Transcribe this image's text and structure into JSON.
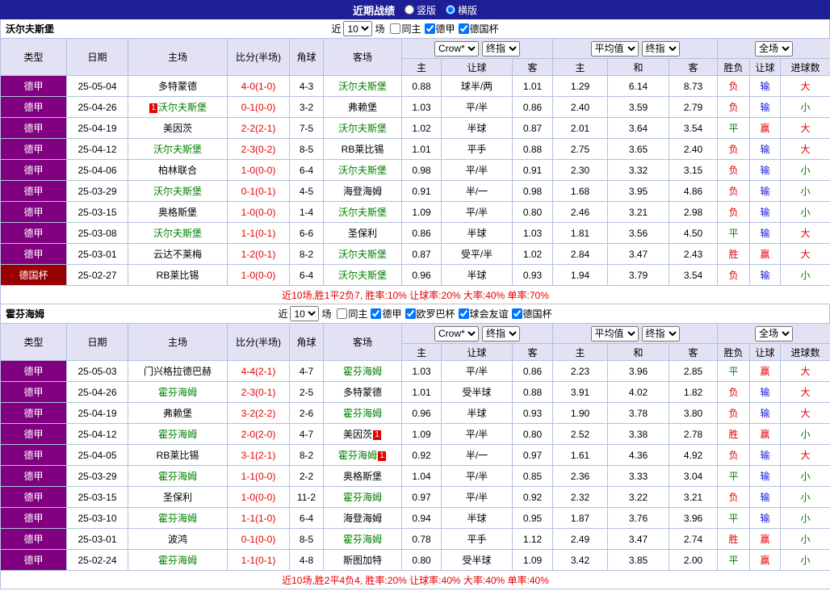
{
  "topbar": {
    "title": "近期战绩",
    "radios": [
      {
        "label": "竖版",
        "checked": false
      },
      {
        "label": "横版",
        "checked": true
      }
    ]
  },
  "colors": {
    "topbar_bg": "#1e1e96",
    "header_bg": "#e2e2f4",
    "border": "#b3c1dd",
    "focus_team": "#008000",
    "score": "#e60000",
    "summary": "#e60000",
    "badge_bg": "#e60000"
  },
  "league_colors": {
    "德甲": "#800080",
    "德国杯": "#990000"
  },
  "value_colors": {
    "胜": "#e60000",
    "平": "#008000",
    "负": "#e60000",
    "赢": "#e60000",
    "输": "#1515dd",
    "大": "#e60000",
    "小": "#008000"
  },
  "sections": [
    {
      "team": "沃尔夫斯堡",
      "filter": {
        "near_label": "近",
        "games_value": "10",
        "games_suffix": "场",
        "checkboxes": [
          {
            "label": "同主",
            "checked": false
          },
          {
            "label": "德甲",
            "checked": true
          },
          {
            "label": "德国杯",
            "checked": true
          }
        ]
      },
      "header": {
        "col_type": "类型",
        "col_date": "日期",
        "col_home": "主场",
        "col_score": "比分(半场)",
        "col_corner": "角球",
        "col_away": "客场",
        "select_company": "Crow*",
        "select_final1": "终指",
        "select_avg": "平均值",
        "select_final2": "终指",
        "select_full": "全场",
        "sub": [
          "主",
          "让球",
          "客",
          "主",
          "和",
          "客",
          "胜负",
          "让球",
          "进球数"
        ]
      },
      "rows": [
        {
          "league": "德甲",
          "date": "25-05-04",
          "home": {
            "name": "多特蒙德"
          },
          "score": "4-0(1-0)",
          "corner": "4-3",
          "away": {
            "name": "沃尔夫斯堡",
            "focus": true
          },
          "odds": [
            "0.88",
            "球半/两",
            "1.01",
            "1.29",
            "6.14",
            "8.73"
          ],
          "results": [
            "负",
            "输",
            "大"
          ]
        },
        {
          "league": "德甲",
          "date": "25-04-26",
          "home": {
            "name": "沃尔夫斯堡",
            "focus": true,
            "badge_before": "1"
          },
          "score": "0-1(0-0)",
          "corner": "3-2",
          "away": {
            "name": "弗赖堡"
          },
          "odds": [
            "1.03",
            "平/半",
            "0.86",
            "2.40",
            "3.59",
            "2.79"
          ],
          "results": [
            "负",
            "输",
            "小"
          ]
        },
        {
          "league": "德甲",
          "date": "25-04-19",
          "home": {
            "name": "美因茨"
          },
          "score": "2-2(2-1)",
          "corner": "7-5",
          "away": {
            "name": "沃尔夫斯堡",
            "focus": true
          },
          "odds": [
            "1.02",
            "半球",
            "0.87",
            "2.01",
            "3.64",
            "3.54"
          ],
          "results": [
            "平",
            "赢",
            "大"
          ]
        },
        {
          "league": "德甲",
          "date": "25-04-12",
          "home": {
            "name": "沃尔夫斯堡",
            "focus": true
          },
          "score": "2-3(0-2)",
          "corner": "8-5",
          "away": {
            "name": "RB莱比锡"
          },
          "odds": [
            "1.01",
            "平手",
            "0.88",
            "2.75",
            "3.65",
            "2.40"
          ],
          "results": [
            "负",
            "输",
            "大"
          ]
        },
        {
          "league": "德甲",
          "date": "25-04-06",
          "home": {
            "name": "柏林联合"
          },
          "score": "1-0(0-0)",
          "corner": "6-4",
          "away": {
            "name": "沃尔夫斯堡",
            "focus": true
          },
          "odds": [
            "0.98",
            "平/半",
            "0.91",
            "2.30",
            "3.32",
            "3.15"
          ],
          "results": [
            "负",
            "输",
            "小"
          ]
        },
        {
          "league": "德甲",
          "date": "25-03-29",
          "home": {
            "name": "沃尔夫斯堡",
            "focus": true
          },
          "score": "0-1(0-1)",
          "corner": "4-5",
          "away": {
            "name": "海登海姆"
          },
          "odds": [
            "0.91",
            "半/一",
            "0.98",
            "1.68",
            "3.95",
            "4.86"
          ],
          "results": [
            "负",
            "输",
            "小"
          ]
        },
        {
          "league": "德甲",
          "date": "25-03-15",
          "home": {
            "name": "奥格斯堡"
          },
          "score": "1-0(0-0)",
          "corner": "1-4",
          "away": {
            "name": "沃尔夫斯堡",
            "focus": true
          },
          "odds": [
            "1.09",
            "平/半",
            "0.80",
            "2.46",
            "3.21",
            "2.98"
          ],
          "results": [
            "负",
            "输",
            "小"
          ]
        },
        {
          "league": "德甲",
          "date": "25-03-08",
          "home": {
            "name": "沃尔夫斯堡",
            "focus": true
          },
          "score": "1-1(0-1)",
          "corner": "6-6",
          "away": {
            "name": "圣保利"
          },
          "odds": [
            "0.86",
            "半球",
            "1.03",
            "1.81",
            "3.56",
            "4.50"
          ],
          "results": [
            "平",
            "输",
            "大"
          ]
        },
        {
          "league": "德甲",
          "date": "25-03-01",
          "home": {
            "name": "云达不莱梅"
          },
          "score": "1-2(0-1)",
          "corner": "8-2",
          "away": {
            "name": "沃尔夫斯堡",
            "focus": true
          },
          "odds": [
            "0.87",
            "受平/半",
            "1.02",
            "2.84",
            "3.47",
            "2.43"
          ],
          "results": [
            "胜",
            "赢",
            "大"
          ]
        },
        {
          "league": "德国杯",
          "date": "25-02-27",
          "home": {
            "name": "RB莱比锡"
          },
          "score": "1-0(0-0)",
          "corner": "6-4",
          "away": {
            "name": "沃尔夫斯堡",
            "focus": true
          },
          "odds": [
            "0.96",
            "半球",
            "0.93",
            "1.94",
            "3.79",
            "3.54"
          ],
          "results": [
            "负",
            "输",
            "小"
          ]
        }
      ],
      "summary": "近10场,胜1平2负7, 胜率:10% 让球率:20% 大率:40% 单率:70%"
    },
    {
      "team": "霍芬海姆",
      "filter": {
        "near_label": "近",
        "games_value": "10",
        "games_suffix": "场",
        "checkboxes": [
          {
            "label": "同主",
            "checked": false
          },
          {
            "label": "德甲",
            "checked": true
          },
          {
            "label": "欧罗巴杯",
            "checked": true
          },
          {
            "label": "球会友谊",
            "checked": true
          },
          {
            "label": "德国杯",
            "checked": true
          }
        ]
      },
      "header": {
        "col_type": "类型",
        "col_date": "日期",
        "col_home": "主场",
        "col_score": "比分(半场)",
        "col_corner": "角球",
        "col_away": "客场",
        "select_company": "Crow*",
        "select_final1": "终指",
        "select_avg": "平均值",
        "select_final2": "终指",
        "select_full": "全场",
        "sub": [
          "主",
          "让球",
          "客",
          "主",
          "和",
          "客",
          "胜负",
          "让球",
          "进球数"
        ]
      },
      "rows": [
        {
          "league": "德甲",
          "date": "25-05-03",
          "home": {
            "name": "门兴格拉德巴赫"
          },
          "score": "4-4(2-1)",
          "corner": "4-7",
          "away": {
            "name": "霍芬海姆",
            "focus": true
          },
          "odds": [
            "1.03",
            "平/半",
            "0.86",
            "2.23",
            "3.96",
            "2.85"
          ],
          "results": [
            "平",
            "赢",
            "大"
          ]
        },
        {
          "league": "德甲",
          "date": "25-04-26",
          "home": {
            "name": "霍芬海姆",
            "focus": true
          },
          "score": "2-3(0-1)",
          "corner": "2-5",
          "away": {
            "name": "多特蒙德"
          },
          "odds": [
            "1.01",
            "受半球",
            "0.88",
            "3.91",
            "4.02",
            "1.82"
          ],
          "results": [
            "负",
            "输",
            "大"
          ]
        },
        {
          "league": "德甲",
          "date": "25-04-19",
          "home": {
            "name": "弗赖堡"
          },
          "score": "3-2(2-2)",
          "corner": "2-6",
          "away": {
            "name": "霍芬海姆",
            "focus": true
          },
          "odds": [
            "0.96",
            "半球",
            "0.93",
            "1.90",
            "3.78",
            "3.80"
          ],
          "results": [
            "负",
            "输",
            "大"
          ]
        },
        {
          "league": "德甲",
          "date": "25-04-12",
          "home": {
            "name": "霍芬海姆",
            "focus": true
          },
          "score": "2-0(2-0)",
          "corner": "4-7",
          "away": {
            "name": "美因茨",
            "badge_after": "1"
          },
          "odds": [
            "1.09",
            "平/半",
            "0.80",
            "2.52",
            "3.38",
            "2.78"
          ],
          "results": [
            "胜",
            "赢",
            "小"
          ]
        },
        {
          "league": "德甲",
          "date": "25-04-05",
          "home": {
            "name": "RB莱比锡"
          },
          "score": "3-1(2-1)",
          "corner": "8-2",
          "away": {
            "name": "霍芬海姆",
            "focus": true,
            "badge_after": "1"
          },
          "odds": [
            "0.92",
            "半/一",
            "0.97",
            "1.61",
            "4.36",
            "4.92"
          ],
          "results": [
            "负",
            "输",
            "大"
          ]
        },
        {
          "league": "德甲",
          "date": "25-03-29",
          "home": {
            "name": "霍芬海姆",
            "focus": true
          },
          "score": "1-1(0-0)",
          "corner": "2-2",
          "away": {
            "name": "奥格斯堡"
          },
          "odds": [
            "1.04",
            "平/半",
            "0.85",
            "2.36",
            "3.33",
            "3.04"
          ],
          "results": [
            "平",
            "输",
            "小"
          ]
        },
        {
          "league": "德甲",
          "date": "25-03-15",
          "home": {
            "name": "圣保利"
          },
          "score": "1-0(0-0)",
          "corner": "11-2",
          "away": {
            "name": "霍芬海姆",
            "focus": true
          },
          "odds": [
            "0.97",
            "平/半",
            "0.92",
            "2.32",
            "3.22",
            "3.21"
          ],
          "results": [
            "负",
            "输",
            "小"
          ]
        },
        {
          "league": "德甲",
          "date": "25-03-10",
          "home": {
            "name": "霍芬海姆",
            "focus": true
          },
          "score": "1-1(1-0)",
          "corner": "6-4",
          "away": {
            "name": "海登海姆"
          },
          "odds": [
            "0.94",
            "半球",
            "0.95",
            "1.87",
            "3.76",
            "3.96"
          ],
          "results": [
            "平",
            "输",
            "小"
          ]
        },
        {
          "league": "德甲",
          "date": "25-03-01",
          "home": {
            "name": "波鸿"
          },
          "score": "0-1(0-0)",
          "corner": "8-5",
          "away": {
            "name": "霍芬海姆",
            "focus": true
          },
          "odds": [
            "0.78",
            "平手",
            "1.12",
            "2.49",
            "3.47",
            "2.74"
          ],
          "results": [
            "胜",
            "赢",
            "小"
          ]
        },
        {
          "league": "德甲",
          "date": "25-02-24",
          "home": {
            "name": "霍芬海姆",
            "focus": true
          },
          "score": "1-1(0-1)",
          "corner": "4-8",
          "away": {
            "name": "斯图加特"
          },
          "odds": [
            "0.80",
            "受半球",
            "1.09",
            "3.42",
            "3.85",
            "2.00"
          ],
          "results": [
            "平",
            "赢",
            "小"
          ]
        }
      ],
      "summary": "近10场,胜2平4负4, 胜率:20% 让球率:40% 大率:40% 单率:40%"
    }
  ]
}
